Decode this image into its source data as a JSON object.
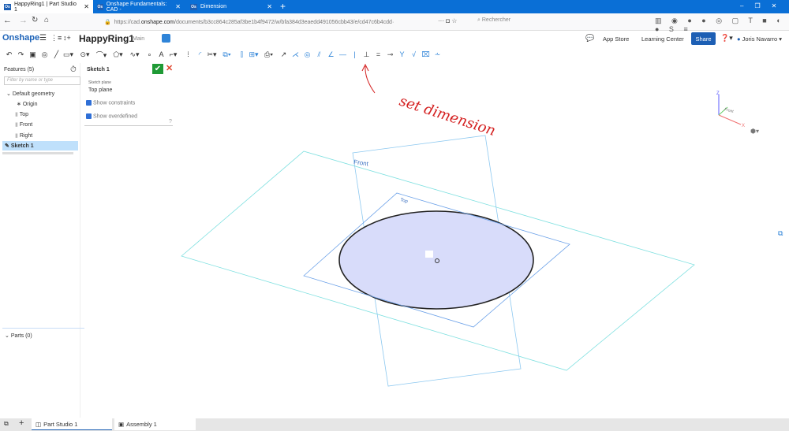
{
  "browser": {
    "tabs": [
      {
        "title": "HappyRing1 | Part Studio 1",
        "active": true
      },
      {
        "title": "Onshape Fundamentals: CAD -",
        "active": false
      },
      {
        "title": "Dimension",
        "active": false
      }
    ],
    "url_prefix": "https://cad.",
    "url_domain": "onshape.com",
    "url_rest": "/documents/b3cc864c285af3be1b4f9472/w/bfa384d3eaedd491056cbb43/e/cd47c6b4cdd·",
    "search_placeholder": "Rechercher"
  },
  "app": {
    "logo": "Onshape",
    "document_title": "HappyRing1",
    "branch": "Main",
    "app_store": "App Store",
    "learning_center": "Learning Center",
    "share": "Share",
    "user": "Joris Navarro",
    "accent": "#1d5fb4"
  },
  "features": {
    "header": "Features (5)",
    "filter_placeholder": "Filter by name or type",
    "items": [
      {
        "label": "Default geometry"
      },
      {
        "label": "Origin"
      },
      {
        "label": "Top"
      },
      {
        "label": "Front"
      },
      {
        "label": "Right"
      },
      {
        "label": "Sketch 1",
        "selected": true
      }
    ],
    "parts": "Parts (0)"
  },
  "sketch": {
    "title": "Sketch 1",
    "plane_label": "Sketch plane",
    "plane_value": "Top plane",
    "show_constraints": "Show constraints",
    "show_overdefined": "Show overdefined"
  },
  "viewport": {
    "front_label": "Front",
    "top_label": "Top",
    "annotation": "set dimension",
    "annotation_color": "#d42020",
    "cube": {
      "z": "Z",
      "x": "X",
      "front": "Front"
    }
  },
  "bottom_tabs": [
    {
      "label": "Part Studio 1",
      "active": true
    },
    {
      "label": "Assembly 1",
      "active": false
    }
  ]
}
